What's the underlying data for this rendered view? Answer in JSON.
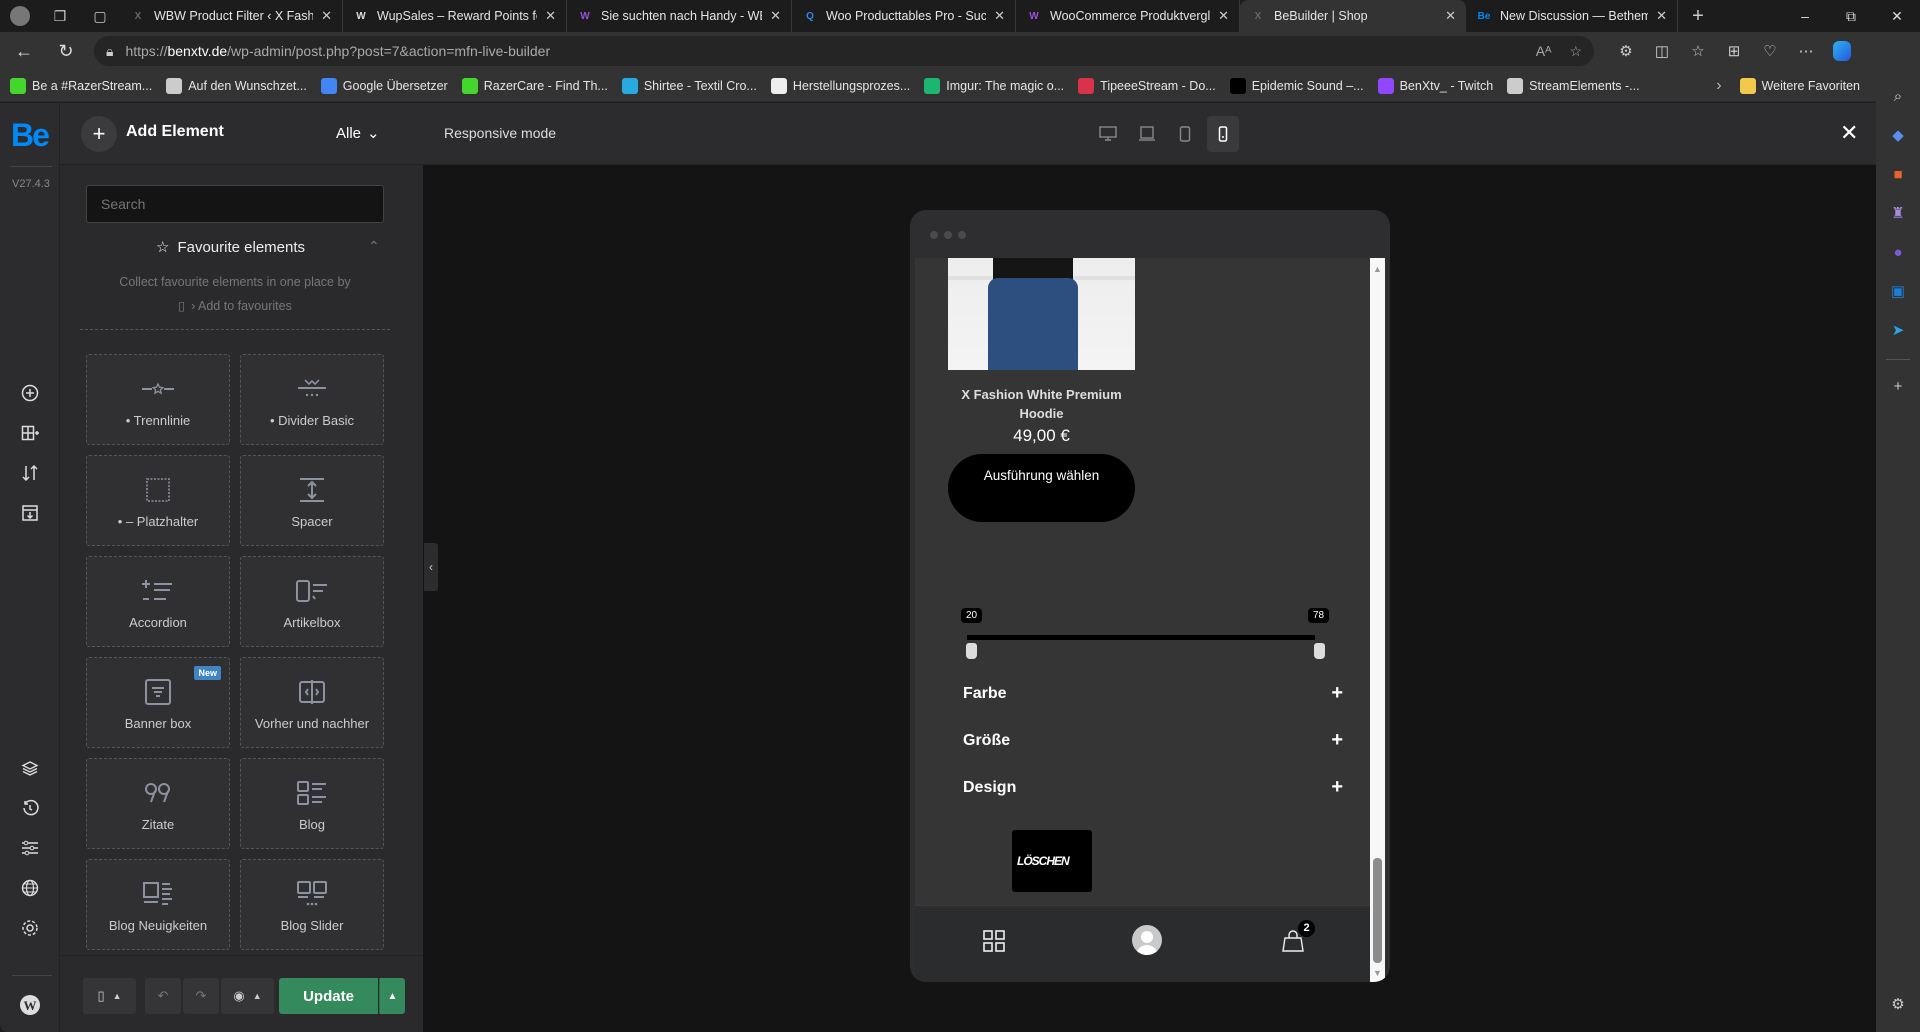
{
  "browser": {
    "tabs": [
      {
        "title": "WBW Product Filter ‹ X Fashion",
        "favicon": "X",
        "fav_color": "#666",
        "active": false
      },
      {
        "title": "WupSales – Reward Points for",
        "favicon": "W",
        "fav_color": "#ddd",
        "active": false
      },
      {
        "title": "Sie suchten nach Handy - WBW",
        "favicon": "W",
        "fav_color": "#9b4de0",
        "active": false
      },
      {
        "title": "Woo Producttables Pro - Such",
        "favicon": "Q",
        "fav_color": "#2f8ae6",
        "active": false
      },
      {
        "title": "WooCommerce Produktvergle",
        "favicon": "W",
        "fav_color": "#9b4de0",
        "active": false
      },
      {
        "title": "BeBuilder | Shop",
        "favicon": "X",
        "fav_color": "#666",
        "active": true
      },
      {
        "title": "New Discussion — Betheme S",
        "favicon": "Be",
        "fav_color": "#0089f7",
        "active": false
      }
    ],
    "new_tab": "+",
    "window_controls": {
      "minimize": "–",
      "restore": "⧉",
      "close": "✕"
    },
    "url": {
      "scheme": "https://",
      "domain": "benxtv.de",
      "path": "/wp-admin/post.php?post=7&action=mfn-live-builder"
    },
    "bookmarks": [
      {
        "label": "Be a #RazerStream...",
        "icon": "razer-icon",
        "color": "#44d62c"
      },
      {
        "label": "Auf den Wunschzet...",
        "icon": "page-icon",
        "color": "#ccc"
      },
      {
        "label": "Google Übersetzer",
        "icon": "google-translate-icon",
        "color": "#4285f4"
      },
      {
        "label": "RazerCare - Find Th...",
        "icon": "razer-icon",
        "color": "#44d62c"
      },
      {
        "label": "Shirtee - Textil Cro...",
        "icon": "shirtee-icon",
        "color": "#29a9e1"
      },
      {
        "label": "Herstellungsprozes...",
        "icon": "page-icon",
        "color": "#eee"
      },
      {
        "label": "Imgur: The magic o...",
        "icon": "imgur-icon",
        "color": "#1bb76e"
      },
      {
        "label": "TipeeeStream - Do...",
        "icon": "tipeee-icon",
        "color": "#d9324a"
      },
      {
        "label": "Epidemic Sound –...",
        "icon": "epidemic-icon",
        "color": "#000"
      },
      {
        "label": "BenXtv_ - Twitch",
        "icon": "twitch-icon",
        "color": "#9146ff"
      },
      {
        "label": "StreamElements -...",
        "icon": "streamelements-icon",
        "color": "#ccc"
      }
    ],
    "more_bookmarks": "Weitere Favoriten"
  },
  "builder": {
    "logo": "Be",
    "version": "V27.4.3",
    "header": {
      "add_element": "Add Element",
      "filter": "Alle",
      "responsive_mode": "Responsive mode",
      "devices": [
        "desktop",
        "laptop",
        "tablet",
        "mobile"
      ],
      "active_device": "mobile"
    },
    "search_placeholder": "Search",
    "favourites": {
      "title": "Favourite elements",
      "desc_line1": "Collect favourite elements in one place by",
      "desc_line2": "› Add to favourites"
    },
    "elements": [
      {
        "label": "• Trennlinie",
        "icon": "divider-star-icon"
      },
      {
        "label": "• Divider Basic",
        "icon": "divider-basic-icon"
      },
      {
        "label": "• – Platzhalter",
        "icon": "placeholder-icon"
      },
      {
        "label": "Spacer",
        "icon": "spacer-icon"
      },
      {
        "label": "Accordion",
        "icon": "accordion-icon"
      },
      {
        "label": "Artikelbox",
        "icon": "article-box-icon"
      },
      {
        "label": "Banner box",
        "icon": "banner-box-icon",
        "badge": "New"
      },
      {
        "label": "Vorher und nachher",
        "icon": "before-after-icon"
      },
      {
        "label": "Zitate",
        "icon": "quote-icon"
      },
      {
        "label": "Blog",
        "icon": "blog-icon"
      },
      {
        "label": "Blog Neuigkeiten",
        "icon": "blog-news-icon"
      },
      {
        "label": "Blog Slider",
        "icon": "blog-slider-icon"
      }
    ],
    "footer": {
      "update": "Update"
    }
  },
  "preview": {
    "product": {
      "title": "X Fashion White Premium Hoodie",
      "price": "49,00 €",
      "button": "Ausführung wählen"
    },
    "price_slider": {
      "min": "20",
      "max": "78"
    },
    "filters": [
      "Farbe",
      "Größe",
      "Design"
    ],
    "clear_button": "LÖSCHEN",
    "cart_count": "2"
  }
}
